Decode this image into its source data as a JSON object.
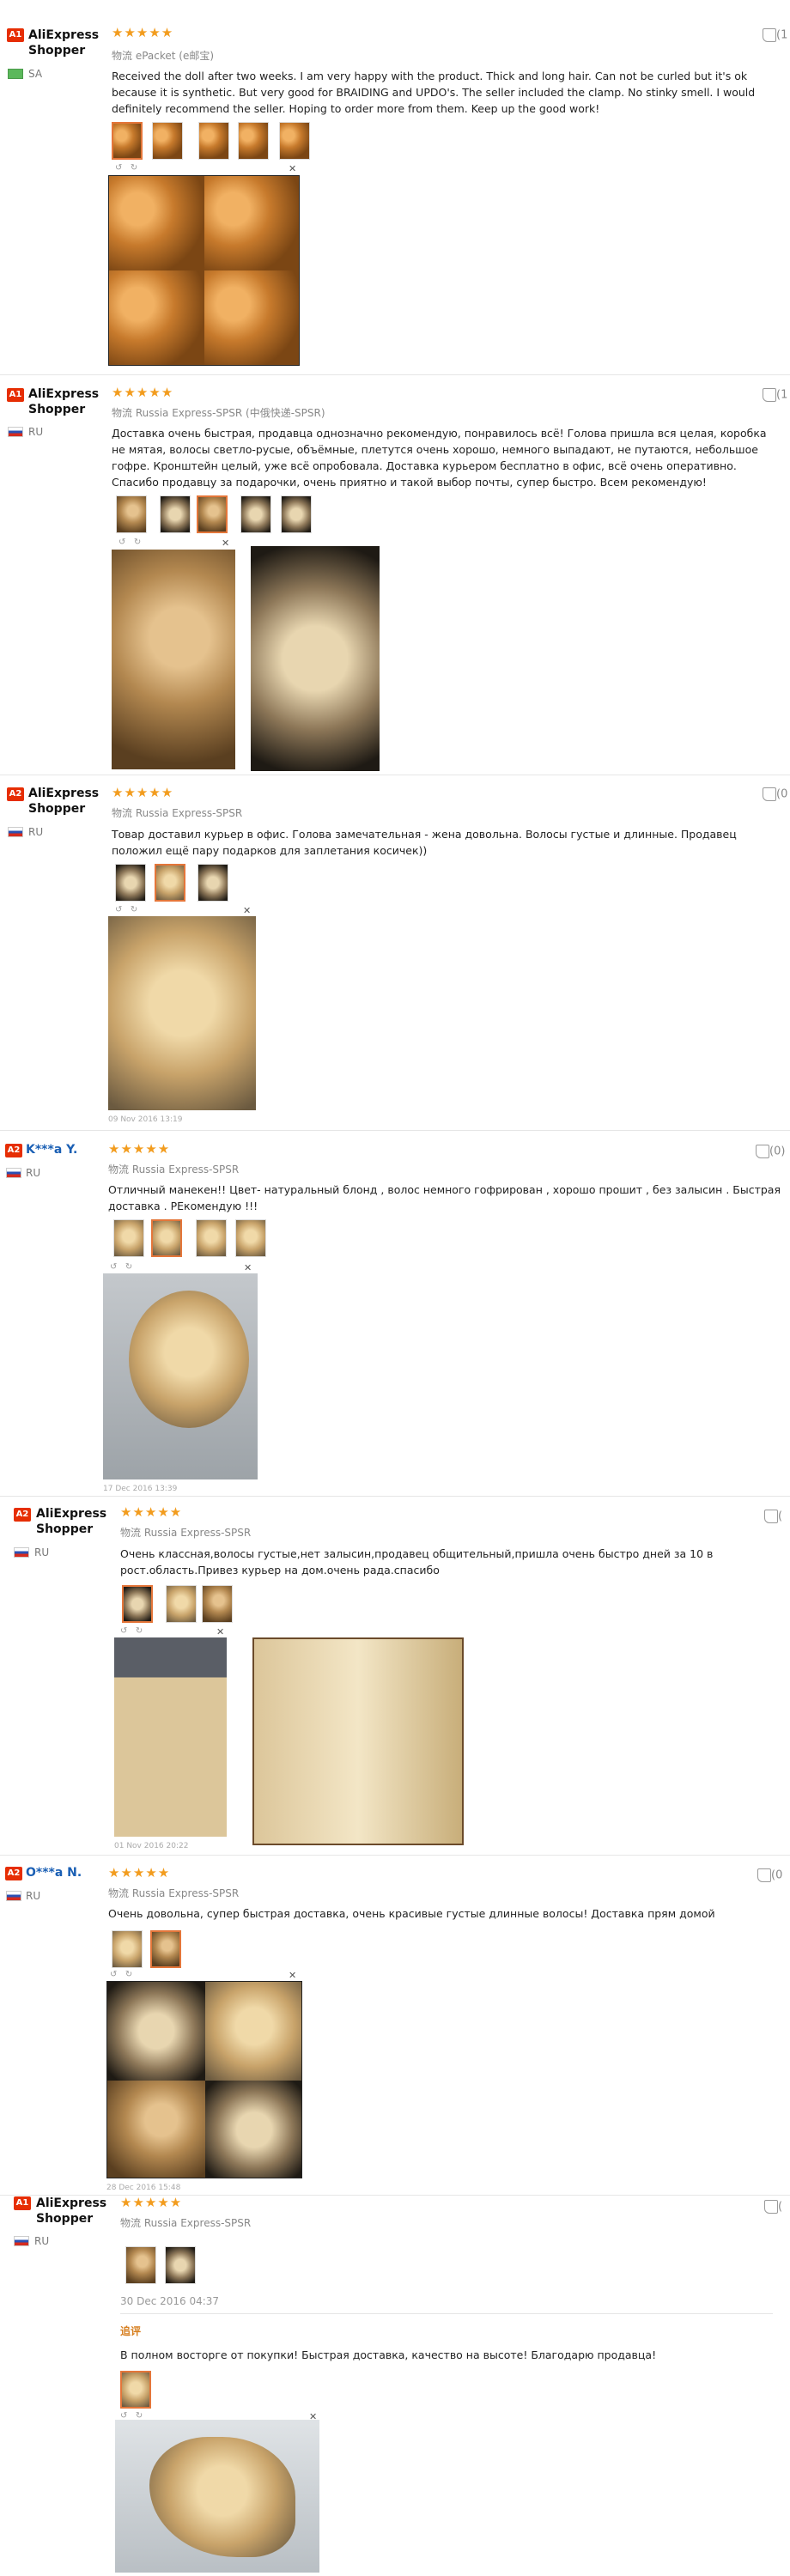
{
  "reviews": [
    {
      "badge": "A1",
      "user": "AliExpress Shopper",
      "country": "SA",
      "flag": "sa",
      "stars": "★★★★★",
      "shipping": "物流 ePacket (e邮宝)",
      "text": "Received the doll after two weeks. I am very happy with the product. Thick and long hair. Can not be curled but it's ok because it is synthetic. But very good for BRAIDING and UPDO's. The seller included the clamp. No stinky smell. I would definitely recommend the seller. Hoping to order more from them. Keep up the good work!",
      "likes": "(1"
    },
    {
      "badge": "A1",
      "user": "AliExpress Shopper",
      "country": "RU",
      "flag": "ru",
      "stars": "★★★★★",
      "shipping": "物流 Russia Express-SPSR (中俄快递-SPSR)",
      "text": "Доставка очень быстрая, продавца однозначно рекомендую, понравилось всё! Голова пришла вся целая, коробка не мятая, волосы светло-русые, объёмные, плетутся очень хорошо, немного выпадают, не путаются, небольшое гофре. Кронштейн целый, уже всё опробовала. Доставка курьером бесплатно в офис, всё очень оперативно. Спасибо продавцу за подарочки, очень приятно и такой выбор почты, супер быстро. Всем рекомендую!",
      "likes": "(1"
    },
    {
      "badge": "A2",
      "user": "AliExpress Shopper",
      "country": "RU",
      "flag": "ru",
      "stars": "★★★★★",
      "shipping": "物流 Russia Express-SPSR",
      "text": "Товар доставил курьер в офис. Голова замечательная - жена довольна. Волосы густые и длинные. Продавец положил ещё пару подарков для заплетания косичек))",
      "date": "09 Nov 2016 13:19",
      "likes": "(0"
    },
    {
      "badge": "A2",
      "user": "K***a Y.",
      "country": "RU",
      "flag": "ru",
      "stars": "★★★★★",
      "shipping": "物流 Russia Express-SPSR",
      "text": "Отличный манекен!! Цвет- натуральный блонд , волос немного гофрирован , хорошо прошит , без залысин . Быстрая доставка . РЕкомендую !!!",
      "date": "17 Dec 2016 13:39",
      "likes": "(0)"
    },
    {
      "badge": "A2",
      "user": "AliExpress Shopper",
      "country": "RU",
      "flag": "ru",
      "stars": "★★★★★",
      "shipping": "物流 Russia Express-SPSR",
      "text": "Очень классная,волосы густые,нет залысин,продавец общительный,пришла очень быстро дней за 10 в рост.область.Привез курьер на дом.очень рада.спасибо",
      "date": "01 Nov 2016 20:22",
      "likes": "("
    },
    {
      "badge": "A2",
      "user": "O***a N.",
      "country": "RU",
      "flag": "ru",
      "stars": "★★★★★",
      "shipping": "物流 Russia Express-SPSR",
      "text": "Очень довольна, супер быстрая доставка, очень красивые густые длинные волосы! Доставка прям домой",
      "date": "28 Dec 2016 15:48",
      "likes": "(0"
    },
    {
      "badge": "A1",
      "user": "AliExpress Shopper",
      "country": "RU",
      "flag": "ru",
      "stars": "★★★★★",
      "shipping": "物流 Russia Express-SPSR",
      "date": "30 Dec 2016 04:37",
      "followup_label": "追评",
      "text": "В полном восторге от покупки! Быстрая доставка, качество на высоте! Благодарю продавца!",
      "likes": "("
    }
  ]
}
